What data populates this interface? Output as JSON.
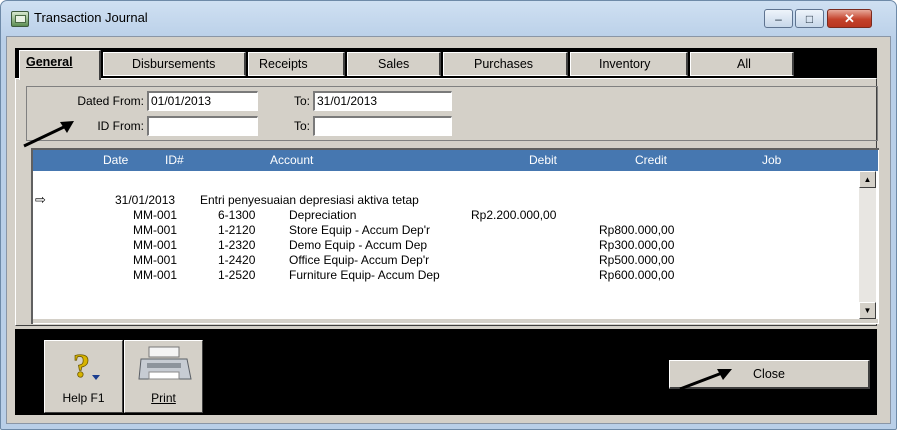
{
  "window": {
    "title": "Transaction Journal",
    "buttons": {
      "minimize": "–",
      "maximize": "□",
      "close": "✕"
    }
  },
  "tabs": [
    {
      "label": "General",
      "active": true
    },
    {
      "label": "Disbursements",
      "active": false
    },
    {
      "label": "Receipts",
      "active": false
    },
    {
      "label": "Sales",
      "active": false
    },
    {
      "label": "Purchases",
      "active": false
    },
    {
      "label": "Inventory",
      "active": false
    },
    {
      "label": "All",
      "active": false
    }
  ],
  "filters": {
    "dated_from_label": "Dated From:",
    "dated_from_value": "01/01/2013",
    "dated_to_label": "To:",
    "dated_to_value": "31/01/2013",
    "id_from_label": "ID From:",
    "id_from_value": "",
    "id_to_label": "To:",
    "id_to_value": ""
  },
  "grid": {
    "columns": [
      "Date",
      "ID#",
      "Account",
      "Debit",
      "Credit",
      "Job"
    ],
    "entry": {
      "pointer_icon": "⇨",
      "date": "31/01/2013",
      "memo": "Entri penyesuaian depresiasi aktiva tetap"
    },
    "rows": [
      {
        "id": "MM-001",
        "acct_no": "6-1300",
        "acct_name": "Depreciation",
        "debit": "Rp2.200.000,00",
        "credit": ""
      },
      {
        "id": "MM-001",
        "acct_no": "1-2120",
        "acct_name": "Store Equip - Accum Dep'r",
        "debit": "",
        "credit": "Rp800.000,00"
      },
      {
        "id": "MM-001",
        "acct_no": "1-2320",
        "acct_name": "Demo Equip - Accum Dep",
        "debit": "",
        "credit": "Rp300.000,00"
      },
      {
        "id": "MM-001",
        "acct_no": "1-2420",
        "acct_name": "Office Equip- Accum Dep'r",
        "debit": "",
        "credit": "Rp500.000,00"
      },
      {
        "id": "MM-001",
        "acct_no": "1-2520",
        "acct_name": "Furniture Equip- Accum Dep",
        "debit": "",
        "credit": "Rp600.000,00"
      }
    ]
  },
  "toolbar": {
    "help_label": "Help F1",
    "help_icon": "question-mark-icon",
    "print_label": "Print",
    "print_icon": "printer-icon",
    "close_label": "Close"
  }
}
